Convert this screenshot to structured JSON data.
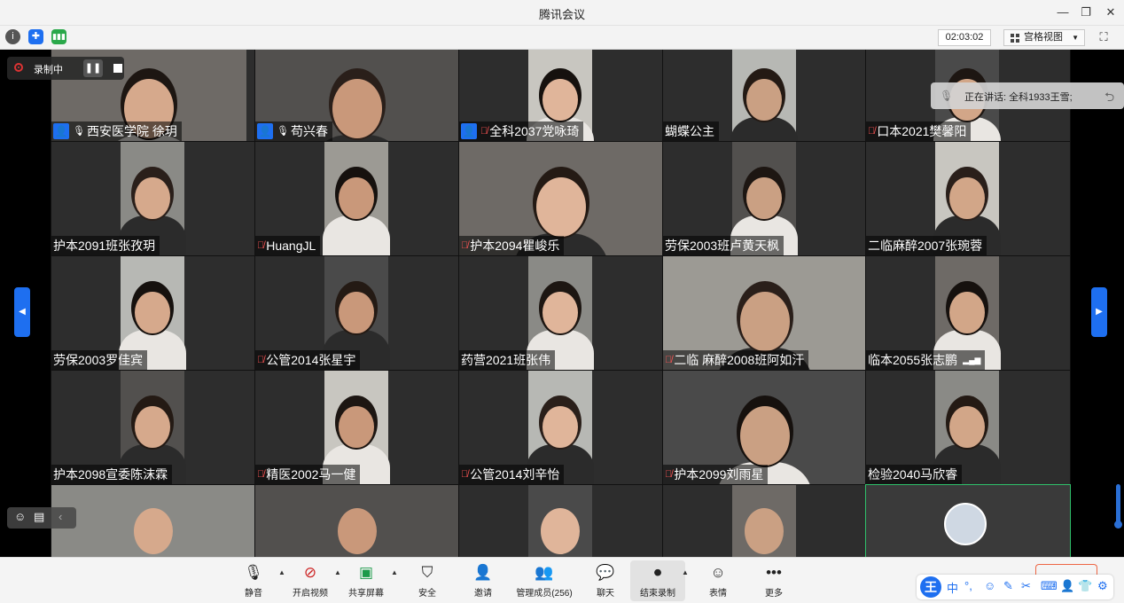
{
  "app": {
    "title": "腾讯会议"
  },
  "toolbar": {
    "timer": "02:03:02",
    "view_label": "宫格视图"
  },
  "recording": {
    "label": "录制中"
  },
  "speaking": {
    "label": "正在讲话: 全科1933王雪;"
  },
  "tiles": [
    {
      "name": "西安医学院 徐玥",
      "host": true,
      "mic": "on"
    },
    {
      "name": "苟兴春",
      "host": true,
      "mic": "on"
    },
    {
      "name": "全科2037党咏琦",
      "host": true,
      "mic": "off"
    },
    {
      "name": "蝴蝶公主",
      "host": false,
      "mic": "none"
    },
    {
      "name": "口本2021樊馨阳",
      "host": false,
      "mic": "off"
    },
    {
      "name": "护本2091班张孜玥",
      "host": false,
      "mic": "none"
    },
    {
      "name": "HuangJL",
      "host": false,
      "mic": "off"
    },
    {
      "name": "护本2094瞿峻乐",
      "host": false,
      "mic": "off"
    },
    {
      "name": "劳保2003班卢黄天枫",
      "host": false,
      "mic": "none"
    },
    {
      "name": "二临麻醉2007张琬蓉",
      "host": false,
      "mic": "none"
    },
    {
      "name": "劳保2003罗佳宾",
      "host": false,
      "mic": "none"
    },
    {
      "name": "公管2014张星宇",
      "host": false,
      "mic": "off"
    },
    {
      "name": "药营2021班张伟",
      "host": false,
      "mic": "none"
    },
    {
      "name": "二临  麻醉2008班阿如汗",
      "host": false,
      "mic": "off"
    },
    {
      "name": "临本2055张志鹏",
      "host": false,
      "mic": "none",
      "signal": true
    },
    {
      "name": "护本2098宣委陈沫霖",
      "host": false,
      "mic": "none"
    },
    {
      "name": "精医2002马一健",
      "host": false,
      "mic": "off"
    },
    {
      "name": "公管2014刘辛怡",
      "host": false,
      "mic": "off"
    },
    {
      "name": "护本2099刘雨星",
      "host": false,
      "mic": "off"
    },
    {
      "name": "检验2040马欣睿",
      "host": false,
      "mic": "none"
    }
  ],
  "bottom": {
    "mute": "静音",
    "video": "开启视频",
    "share": "共享屏幕",
    "security": "安全",
    "invite": "邀请",
    "members": "管理成员(256)",
    "chat": "聊天",
    "stop_record": "结束录制",
    "reaction": "表情",
    "more": "更多"
  },
  "ime": {
    "lang": "中"
  },
  "colors": {
    "accent": "#1e6ff0",
    "mic_off": "#ff5555",
    "record": "#dd3333"
  }
}
